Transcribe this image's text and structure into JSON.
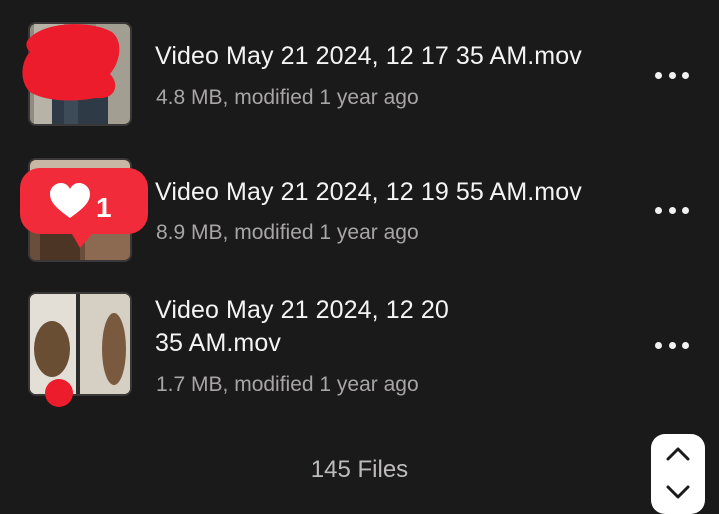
{
  "files": [
    {
      "name": "Video May 21 2024, 12 17 35 AM.mov",
      "meta": "4.8 MB, modified 1 year ago"
    },
    {
      "name": "Video May 21 2024, 12 19 55 AM.mov",
      "meta": "8.9 MB, modified 1 year ago"
    },
    {
      "name_line1": "Video May 21 2024, 12 20",
      "name_line2": "35 AM.mov",
      "meta": "1.7 MB, modified 1 year ago"
    }
  ],
  "heart_badge": {
    "count": "1"
  },
  "footer": {
    "file_count": "145 Files"
  },
  "icons": {
    "more": "more-horizontal-icon",
    "scroll_top": "chevron-up-icon",
    "heart": "heart-icon"
  },
  "colors": {
    "background": "#1b1a1a",
    "text_primary": "#f4f4f4",
    "text_secondary": "#a7a5a5",
    "redaction": "#ec1c2c"
  }
}
